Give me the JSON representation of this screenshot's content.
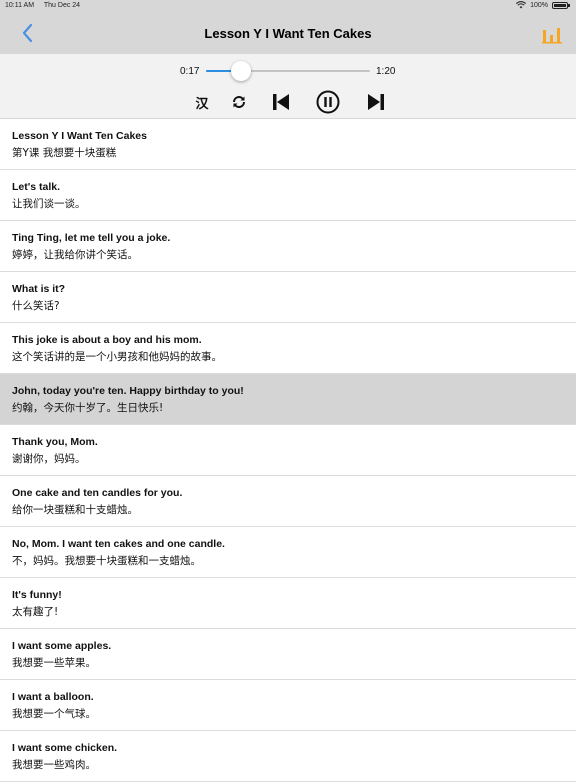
{
  "status": {
    "time": "10:11 AM",
    "date": "Thu Dec 24",
    "battery_text": "100%",
    "battery_level": 1.0
  },
  "nav": {
    "title": "Lesson Y I Want Ten Cakes",
    "back_icon": "chevron-left-icon",
    "right_icon": "bar-chart-icon",
    "accent_color": "#4a90e2",
    "chart_color": "#f5a623"
  },
  "player": {
    "current_time": "0:17",
    "duration": "1:20",
    "progress": 0.2125,
    "han_label": "汉",
    "played_color": "#2a8ee0"
  },
  "lines": [
    {
      "en": "Lesson Y I Want Ten Cakes",
      "zh": "第Y课 我想要十块蛋糕"
    },
    {
      "en": "Let's talk.",
      "zh": "让我们谈一谈。"
    },
    {
      "en": "Ting Ting, let me tell you a joke.",
      "zh": "婷婷，让我给你讲个笑话。"
    },
    {
      "en": "What is it?",
      "zh": "什么笑话?"
    },
    {
      "en": "This joke is about a boy and his mom.",
      "zh": "这个笑话讲的是一个小男孩和他妈妈的故事。"
    },
    {
      "en": "John, today you're ten. Happy birthday to you!",
      "zh": "约翰，今天你十岁了。生日快乐!"
    },
    {
      "en": "Thank you, Mom.",
      "zh": "谢谢你，妈妈。"
    },
    {
      "en": "One cake and ten candles for you.",
      "zh": "给你一块蛋糕和十支蜡烛。"
    },
    {
      "en": "No, Mom. I want ten cakes and one candle.",
      "zh": "不，妈妈。我想要十块蛋糕和一支蜡烛。"
    },
    {
      "en": "It's funny!",
      "zh": "太有趣了!"
    },
    {
      "en": "I want some apples.",
      "zh": "我想要一些苹果。"
    },
    {
      "en": "I want a balloon.",
      "zh": "我想要一个气球。"
    },
    {
      "en": "I want some chicken.",
      "zh": "我想要一些鸡肉。"
    }
  ],
  "active_index": 5
}
